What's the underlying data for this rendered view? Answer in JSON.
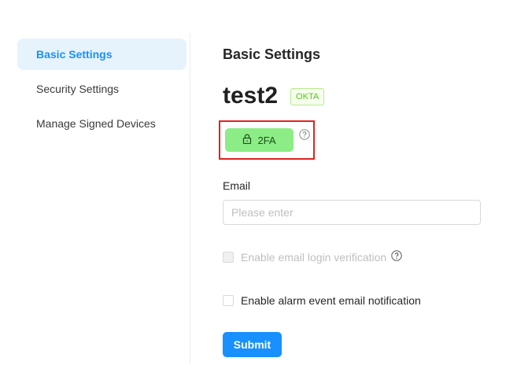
{
  "sidebar": {
    "items": [
      {
        "label": "Basic Settings",
        "active": true
      },
      {
        "label": "Security Settings",
        "active": false
      },
      {
        "label": "Manage Signed Devices",
        "active": false
      }
    ]
  },
  "main": {
    "title": "Basic Settings",
    "username": "test2",
    "provider_badge": "OKTA",
    "twofa_button": {
      "label": "2FA",
      "icon": "lock-icon",
      "color": "#8ced86",
      "highlight_border": "#e0231e"
    },
    "help_icon": "question-circle-icon",
    "email": {
      "label": "Email",
      "placeholder": "Please enter",
      "value": ""
    },
    "options": [
      {
        "label": "Enable email login verification",
        "checked": false,
        "disabled": true,
        "has_help": true
      },
      {
        "label": "Enable alarm event email notification",
        "checked": false,
        "disabled": false,
        "has_help": false
      }
    ],
    "submit_label": "Submit"
  },
  "colors": {
    "accent": "#1890ff",
    "active_bg": "#e6f3fd",
    "okta_green": "#52c41a"
  }
}
